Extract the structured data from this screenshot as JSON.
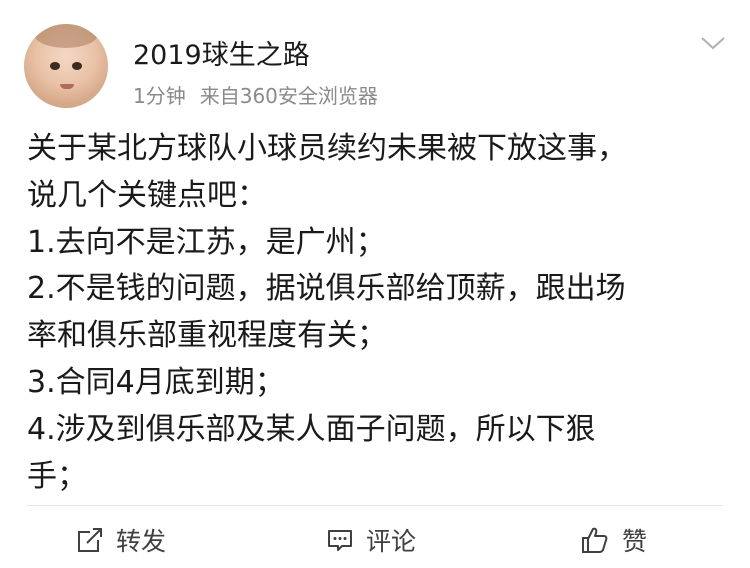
{
  "post": {
    "username": "2019球生之路",
    "time": "1分钟",
    "source": "来自360安全浏览器",
    "lines": [
      "关于某北方球队小球员续约未果被下放这事，",
      "说几个关键点吧：",
      "1.去向不是江苏，是广州；",
      "2.不是钱的问题，据说俱乐部给顶薪，跟出场",
      "率和俱乐部重视程度有关；",
      "3.合同4月底到期；",
      "4.涉及到俱乐部及某人面子问题，所以下狠",
      "手；"
    ]
  },
  "actions": {
    "repost_label": "转发",
    "comment_label": "评论",
    "like_label": "赞"
  },
  "icons": {
    "avatar": "baby-avatar",
    "chevron": "chevron-down-icon",
    "repost": "repost-icon",
    "comment": "comment-icon",
    "like": "thumbs-up-icon"
  }
}
